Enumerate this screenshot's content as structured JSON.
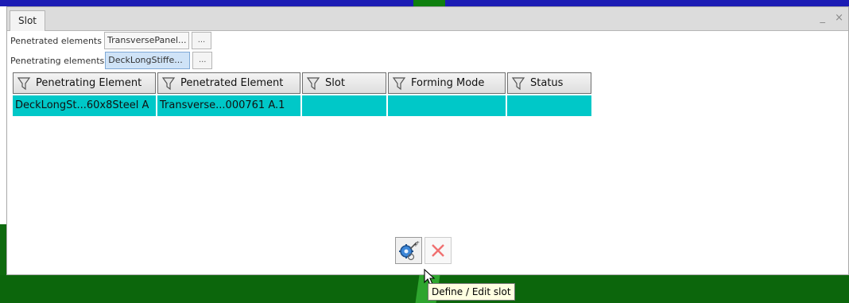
{
  "window": {
    "title": "Slot",
    "controls": "_ ×"
  },
  "fields": {
    "penetrated": {
      "label": "Penetrated elements",
      "value": "TransversePanel...",
      "browse_label": "..."
    },
    "penetrating": {
      "label": "Penetrating elements",
      "value": "DeckLongStiffe...",
      "browse_label": "..."
    }
  },
  "table": {
    "columns": [
      "Penetrating Element",
      "Penetrated Element",
      "Slot",
      "Forming Mode",
      "Status"
    ],
    "rows": [
      [
        "DeckLongSt...60x8Steel A",
        "Transverse...000761 A.1",
        "",
        "",
        ""
      ]
    ],
    "row_color": "#00c8c8"
  },
  "toolbar": {
    "define_edit_icon": "gear-wand-icon",
    "delete_icon": "red-x-icon"
  },
  "tooltip": {
    "text": "Define / Edit slot"
  }
}
